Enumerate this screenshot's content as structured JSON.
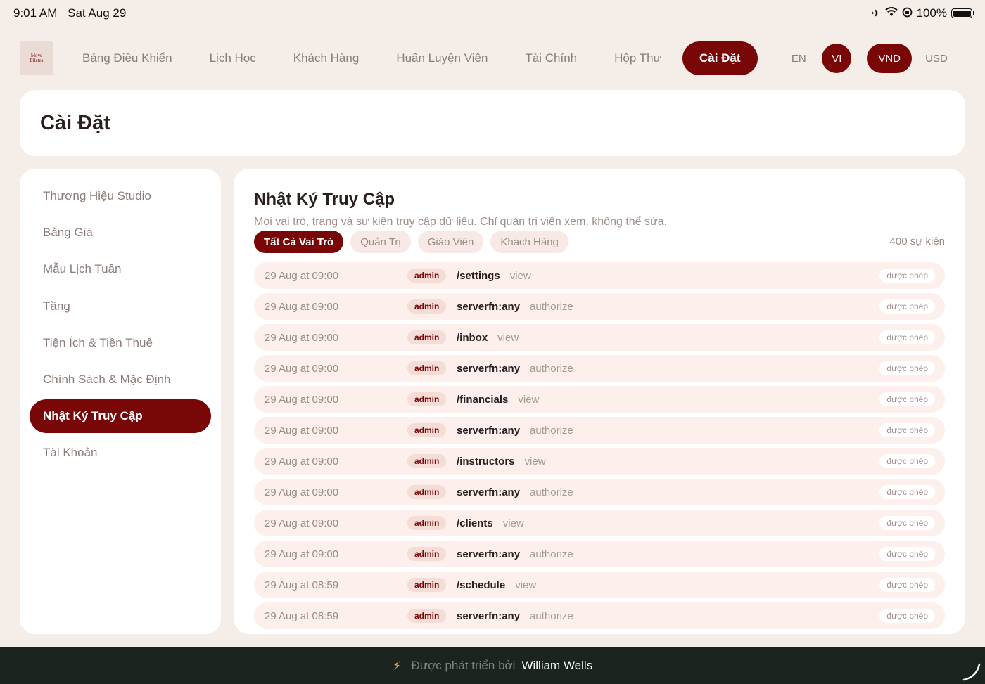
{
  "status_bar": {
    "time": "9:01 AM",
    "date": "Sat Aug 29",
    "battery": "100%"
  },
  "logo": {
    "line1": "Move",
    "line2": "Pilates"
  },
  "nav": {
    "items": [
      {
        "label": "Bảng Điều Khiển"
      },
      {
        "label": "Lịch Học"
      },
      {
        "label": "Khách Hàng"
      },
      {
        "label": "Huấn Luyện Viên"
      },
      {
        "label": "Tài Chính"
      },
      {
        "label": "Hộp Thư"
      },
      {
        "label": "Cài Đặt",
        "active": true
      }
    ],
    "lang_en": "EN",
    "lang_vi": "VI",
    "currency_vnd": "VND",
    "currency_usd": "USD"
  },
  "page_title": "Cài Đặt",
  "sidebar": {
    "items": [
      {
        "label": "Thương Hiệu Studio"
      },
      {
        "label": "Bảng Giá"
      },
      {
        "label": "Mẫu Lịch Tuần"
      },
      {
        "label": "Tầng"
      },
      {
        "label": "Tiện Ích & Tiền Thuê"
      },
      {
        "label": "Chính Sách & Mặc Định"
      },
      {
        "label": "Nhật Ký Truy Cập",
        "active": true
      },
      {
        "label": "Tài Khoản"
      }
    ]
  },
  "main": {
    "title": "Nhật Ký Truy Cập",
    "subtitle": "Mọi vai trò, trang và sự kiện truy cập dữ liệu. Chỉ quản trị viên xem, không thể sửa.",
    "filters": [
      {
        "label": "Tất Cả Vai Trò",
        "active": true
      },
      {
        "label": "Quản Trị"
      },
      {
        "label": "Giáo Viên"
      },
      {
        "label": "Khách Hàng"
      }
    ],
    "event_count": "400 sự kiện",
    "rows": [
      {
        "time": "29 Aug at 09:00",
        "role": "admin",
        "path": "/settings",
        "action": "view",
        "status": "được phép"
      },
      {
        "time": "29 Aug at 09:00",
        "role": "admin",
        "path": "serverfn:any",
        "action": "authorize",
        "status": "được phép"
      },
      {
        "time": "29 Aug at 09:00",
        "role": "admin",
        "path": "/inbox",
        "action": "view",
        "status": "được phép"
      },
      {
        "time": "29 Aug at 09:00",
        "role": "admin",
        "path": "serverfn:any",
        "action": "authorize",
        "status": "được phép"
      },
      {
        "time": "29 Aug at 09:00",
        "role": "admin",
        "path": "/financials",
        "action": "view",
        "status": "được phép"
      },
      {
        "time": "29 Aug at 09:00",
        "role": "admin",
        "path": "serverfn:any",
        "action": "authorize",
        "status": "được phép"
      },
      {
        "time": "29 Aug at 09:00",
        "role": "admin",
        "path": "/instructors",
        "action": "view",
        "status": "được phép"
      },
      {
        "time": "29 Aug at 09:00",
        "role": "admin",
        "path": "serverfn:any",
        "action": "authorize",
        "status": "được phép"
      },
      {
        "time": "29 Aug at 09:00",
        "role": "admin",
        "path": "/clients",
        "action": "view",
        "status": "được phép"
      },
      {
        "time": "29 Aug at 09:00",
        "role": "admin",
        "path": "serverfn:any",
        "action": "authorize",
        "status": "được phép"
      },
      {
        "time": "29 Aug at 08:59",
        "role": "admin",
        "path": "/schedule",
        "action": "view",
        "status": "được phép"
      },
      {
        "time": "29 Aug at 08:59",
        "role": "admin",
        "path": "serverfn:any",
        "action": "authorize",
        "status": "được phép"
      }
    ]
  },
  "footer": {
    "text": "Được phát triển bởi",
    "author": "William Wells"
  },
  "colors": {
    "accent": "#7a0707",
    "background": "#f5ede8",
    "footer": "#1c2420"
  }
}
